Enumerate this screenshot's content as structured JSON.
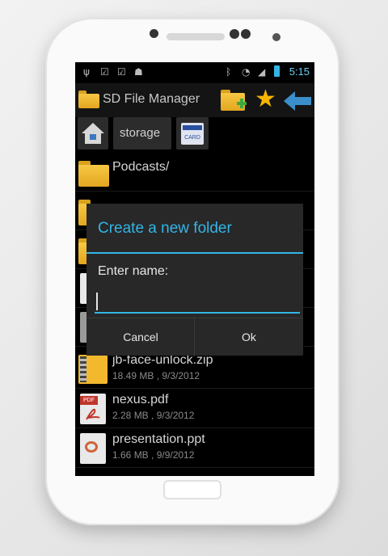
{
  "status_bar": {
    "time": "5:15"
  },
  "app_bar": {
    "title": "SD File Manager"
  },
  "breadcrumb": {
    "storage_label": "storage",
    "sdcard_label": "CARD"
  },
  "files": [
    {
      "name": "Podcasts/",
      "meta": ""
    },
    {
      "name": "jb-face-unlock.zip",
      "meta": "18.49 MB , 9/3/2012"
    },
    {
      "name": "nexus.pdf",
      "meta": "2.28 MB , 9/3/2012",
      "icon_label": "PDF"
    },
    {
      "name": "presentation.ppt",
      "meta": "1.66 MB , 9/9/2012"
    }
  ],
  "dialog": {
    "title": "Create a new folder",
    "prompt": "Enter name:",
    "input_value": "",
    "cancel_label": "Cancel",
    "ok_label": "Ok"
  },
  "colors": {
    "accent": "#33b5e5",
    "folder": "#f2b92e"
  }
}
